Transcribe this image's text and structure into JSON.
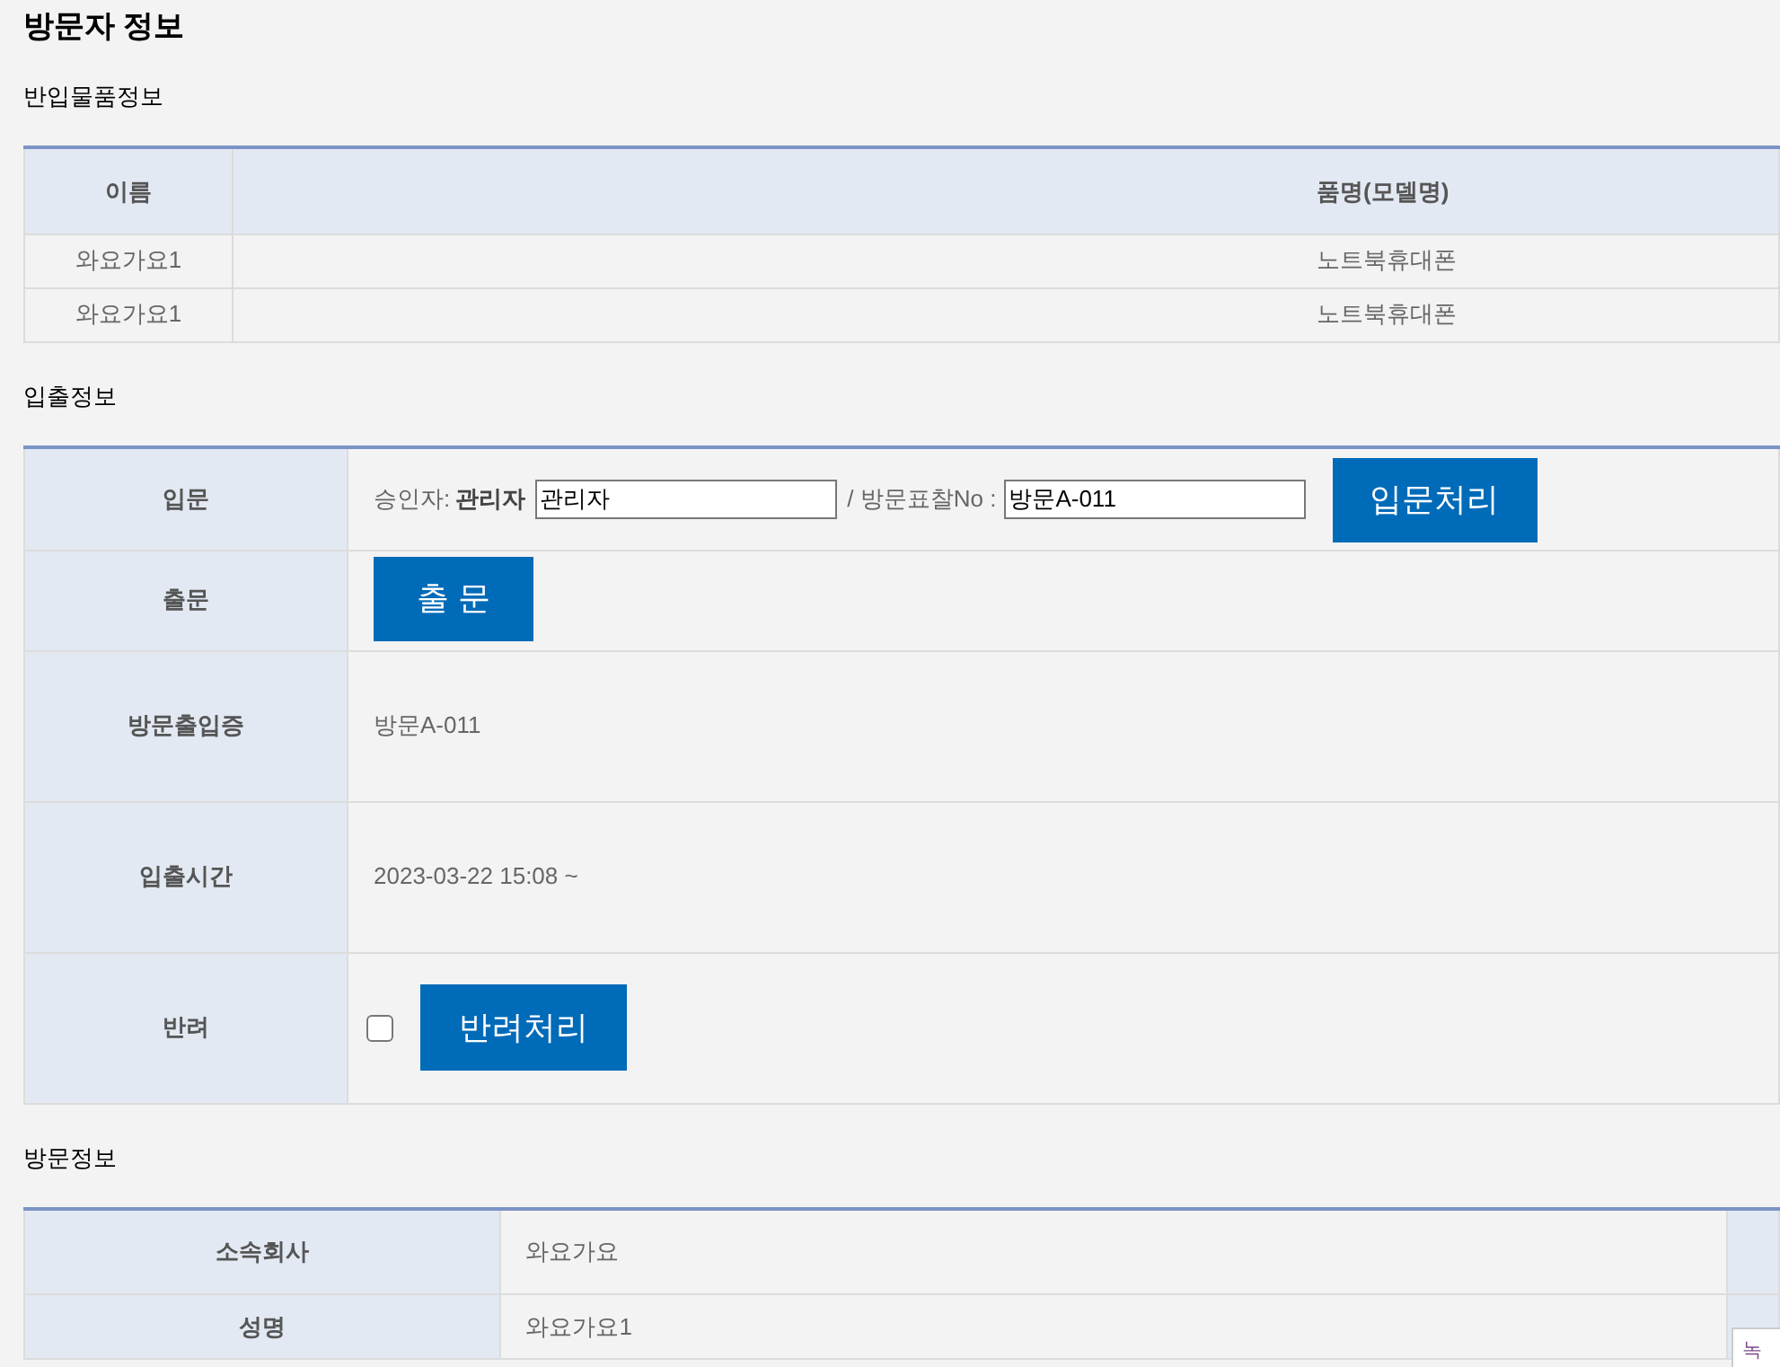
{
  "title": "방문자 정보",
  "items_section": {
    "heading": "반입물품정보",
    "columns": [
      "이름",
      "품명(모델명)"
    ],
    "rows": [
      [
        "와요가요1",
        "노트북휴대폰"
      ],
      [
        "와요가요1",
        "노트북휴대폰"
      ]
    ]
  },
  "access_section": {
    "heading": "입출정보",
    "rows": [
      {
        "kind": "entry",
        "label": "입문",
        "approver_label": "승인자:",
        "approver_name": "관리자",
        "approver_value": "관리자",
        "badge_label": "/ 방문표찰No :",
        "badge_value": "방문A-011",
        "button": "입문처리"
      },
      {
        "kind": "exit",
        "label": "출문",
        "button": "출 문"
      },
      {
        "kind": "text",
        "label": "방문출입증",
        "value": "방문A-011"
      },
      {
        "kind": "text",
        "label": "입출시간",
        "value": "2023-03-22 15:08 ~"
      },
      {
        "kind": "reject",
        "label": "반려",
        "checked": false,
        "button": "반려처리"
      }
    ]
  },
  "visit_section": {
    "heading": "방문정보",
    "rows": [
      {
        "label": "소속회사",
        "value": "와요가요"
      },
      {
        "label": "성명",
        "value": "와요가요1"
      }
    ]
  },
  "side_tab": {
    "label": "녹"
  }
}
